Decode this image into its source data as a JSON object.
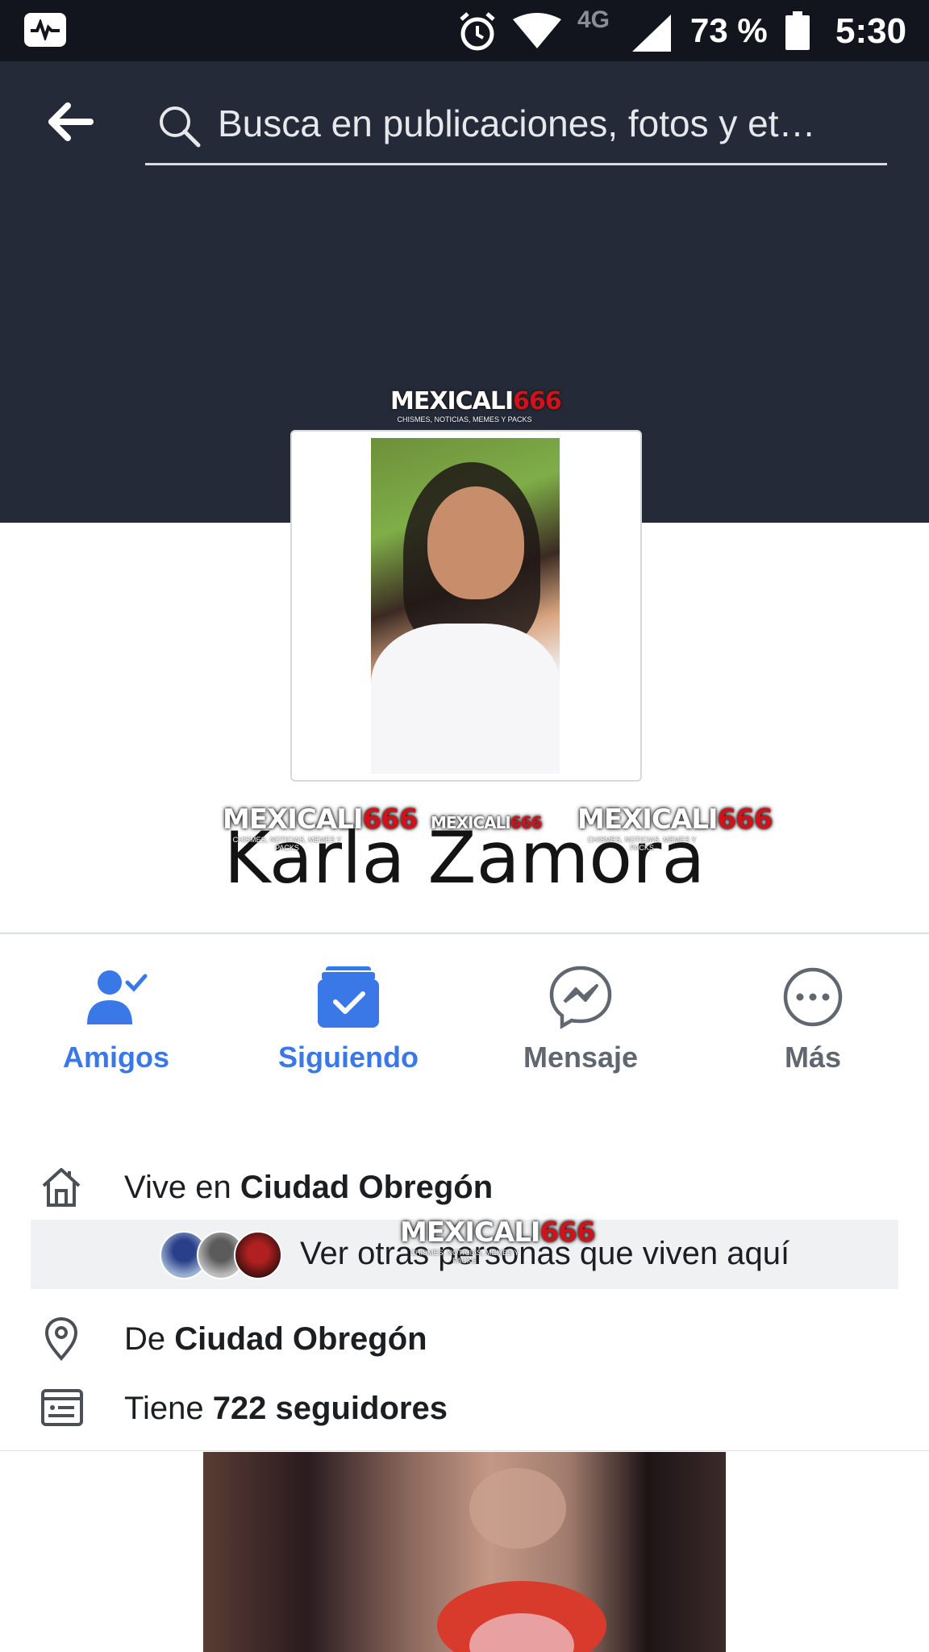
{
  "status_bar": {
    "network": "4G",
    "battery": "73 %",
    "time": "5:30",
    "icons": [
      "activity-icon",
      "alarm-icon",
      "wifi-icon",
      "signal-icon",
      "battery-icon"
    ]
  },
  "header": {
    "search_text": "Busca en publicaciones, fotos y et…"
  },
  "watermark": {
    "brand_white": "MEXICALI",
    "brand_red": "666",
    "tagline": "CHISMES, NOTICIAS, MEMES Y PACKS"
  },
  "profile": {
    "name": "Karla Zamora"
  },
  "actions": [
    {
      "label": "Amigos",
      "icon": "friends-check-icon"
    },
    {
      "label": "Siguiendo",
      "icon": "following-check-icon"
    },
    {
      "label": "Mensaje",
      "icon": "messenger-icon"
    },
    {
      "label": "Más",
      "icon": "more-icon"
    }
  ],
  "info": {
    "lives_prefix": "Vive en ",
    "lives_city": "Ciudad Obregón",
    "others_text": "Ver otras personas que viven aquí",
    "from_prefix": "De ",
    "from_city": "Ciudad Obregón",
    "followers_prefix": "Tiene ",
    "followers_count": "722 seguidores"
  },
  "colors": {
    "accent": "#3b78e7",
    "header_bg": "#242a38",
    "status_bg": "#12151d",
    "watermark_red": "#d0121b"
  }
}
